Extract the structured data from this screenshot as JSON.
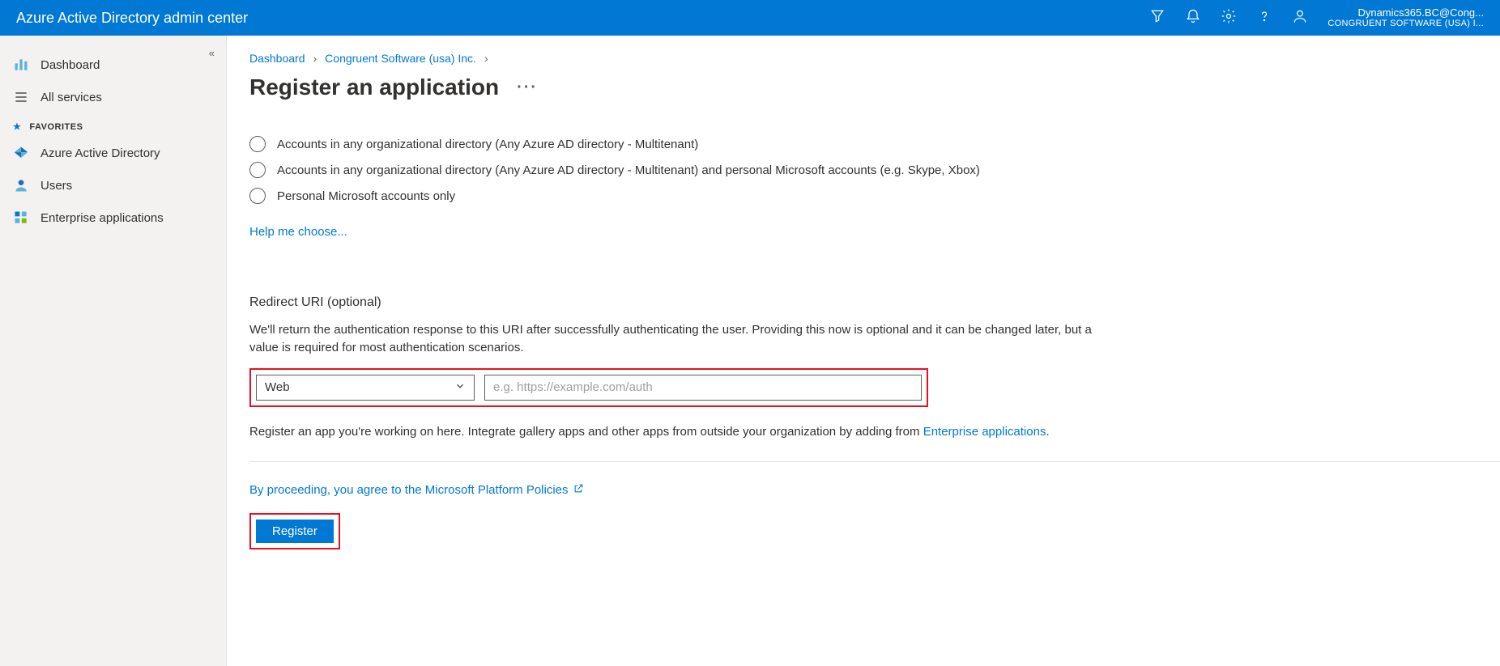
{
  "header": {
    "title": "Azure Active Directory admin center",
    "account_line1": "Dynamics365.BC@Cong...",
    "account_line2": "CONGRUENT SOFTWARE (USA) I..."
  },
  "sidebar": {
    "dashboard": "Dashboard",
    "all_services": "All services",
    "favorites_label": "FAVORITES",
    "aad": "Azure Active Directory",
    "users": "Users",
    "enterprise_apps": "Enterprise applications"
  },
  "breadcrumb": {
    "dashboard": "Dashboard",
    "org": "Congruent Software (usa) Inc."
  },
  "page": {
    "title": "Register an application"
  },
  "radios": {
    "opt2": "Accounts in any organizational directory (Any Azure AD directory - Multitenant)",
    "opt3": "Accounts in any organizational directory (Any Azure AD directory - Multitenant) and personal Microsoft accounts (e.g. Skype, Xbox)",
    "opt4": "Personal Microsoft accounts only"
  },
  "links": {
    "help_choose": "Help me choose...",
    "enterprise_apps": "Enterprise applications",
    "policies": "By proceeding, you agree to the Microsoft Platform Policies"
  },
  "redirect": {
    "title": "Redirect URI (optional)",
    "desc": "We'll return the authentication response to this URI after successfully authenticating the user. Providing this now is optional and it can be changed later, but a value is required for most authentication scenarios.",
    "select_value": "Web",
    "placeholder": "e.g. https://example.com/auth"
  },
  "footnote_prefix": "Register an app you're working on here. Integrate gallery apps and other apps from outside your organization by adding from ",
  "buttons": {
    "register": "Register"
  }
}
